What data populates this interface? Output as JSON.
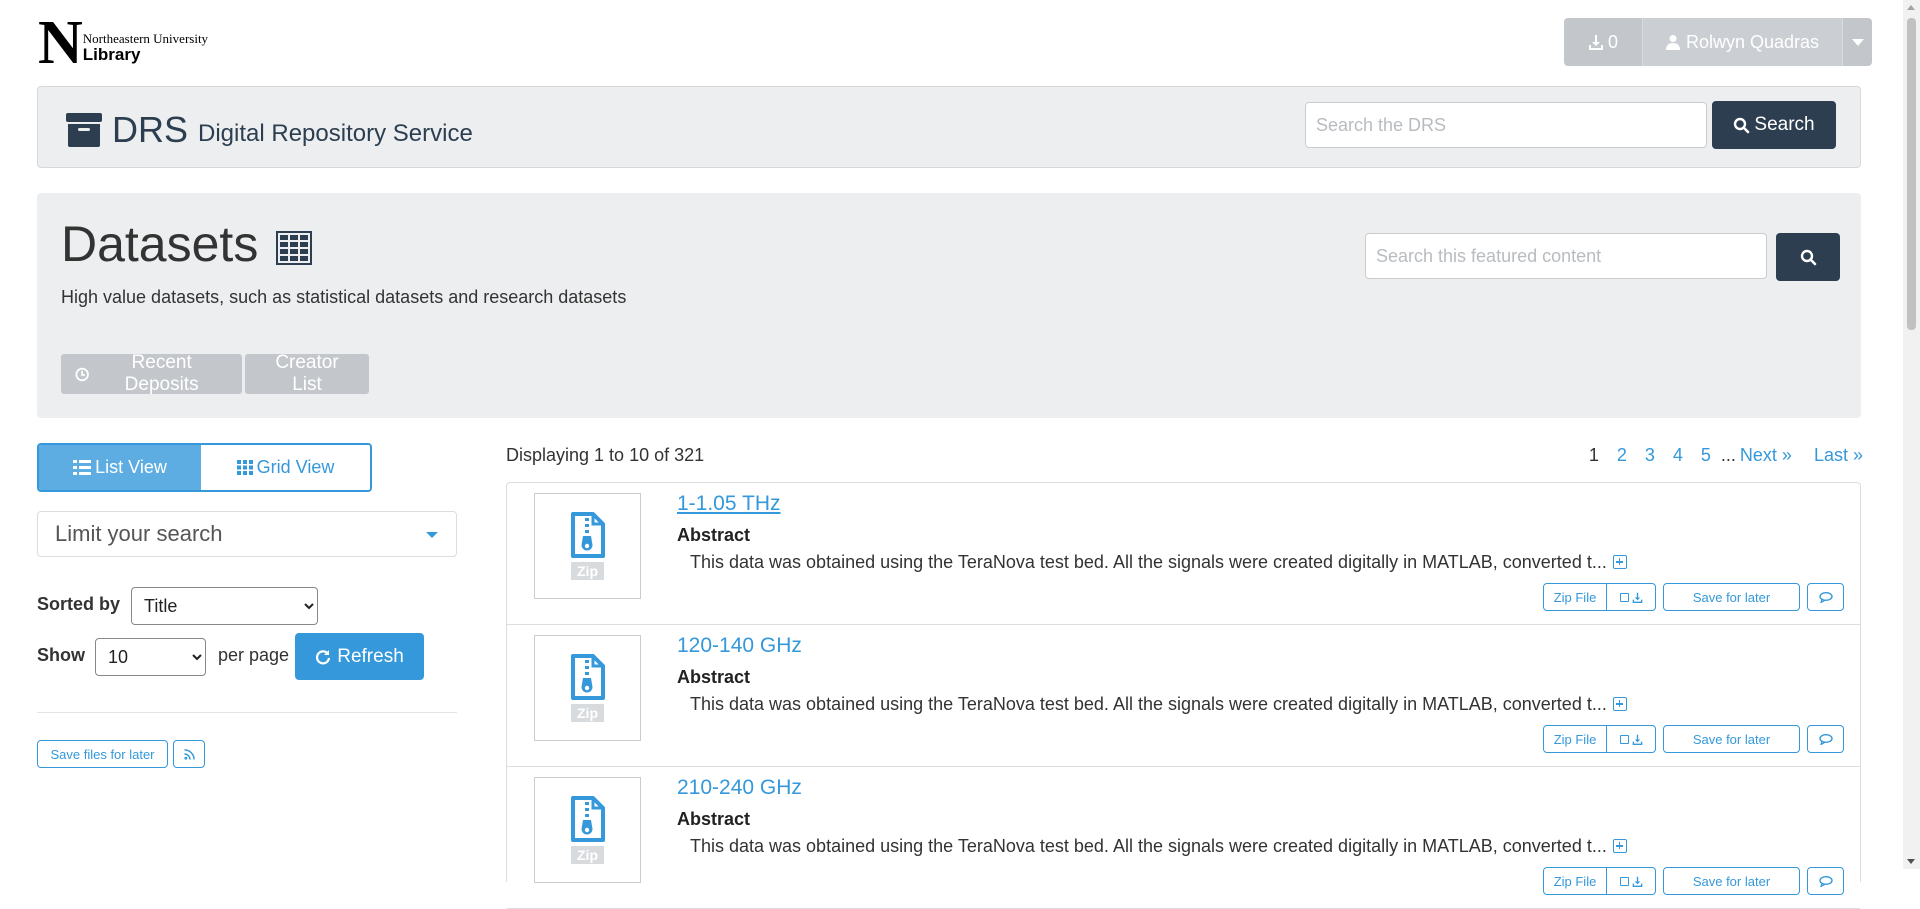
{
  "logo": {
    "letter": "N",
    "university": "Northeastern University",
    "library": "Library"
  },
  "user_menu": {
    "download_count": "0",
    "user_name": "Rolwyn Quadras"
  },
  "drs": {
    "title": "DRS",
    "subtitle": "Digital Repository Service",
    "search_placeholder": "Search the DRS",
    "search_button": "Search"
  },
  "banner": {
    "title": "Datasets",
    "description": "High value datasets, such as statistical datasets and research datasets",
    "search_placeholder": "Search this featured content",
    "buttons": {
      "recent": "Recent Deposits",
      "creators": "Creator List"
    }
  },
  "view": {
    "list_label": "List View",
    "grid_label": "Grid View"
  },
  "filters": {
    "limit_label": "Limit your search",
    "sorted_by_label": "Sorted by",
    "sort_value": "Title",
    "show_label": "Show",
    "show_value": "10",
    "per_page_label": "per page",
    "refresh_label": "Refresh"
  },
  "left_actions": {
    "save_files_label": "Save files for later"
  },
  "results": {
    "summary": "Displaying 1 to 10 of 321",
    "pages": [
      "1",
      "2",
      "3",
      "4",
      "5"
    ],
    "ellipsis": "...",
    "next_label": "Next »",
    "last_label": "Last »",
    "items": [
      {
        "title": "1-1.05 THz",
        "abstract_label": "Abstract",
        "abstract": "This data was obtained using the TeraNova test bed. All the signals were created digitally in MATLAB, converted t...",
        "thumb_label": "Zip",
        "zip_label": "Zip File",
        "save_label": "Save for later"
      },
      {
        "title": "120-140 GHz",
        "abstract_label": "Abstract",
        "abstract": "This data was obtained using the TeraNova test bed. All the signals were created digitally in MATLAB, converted t...",
        "thumb_label": "Zip",
        "zip_label": "Zip File",
        "save_label": "Save for later"
      },
      {
        "title": "210-240 GHz",
        "abstract_label": "Abstract",
        "abstract": "This data was obtained using the TeraNova test bed. All the signals were created digitally in MATLAB, converted t...",
        "thumb_label": "Zip",
        "zip_label": "Zip File",
        "save_label": "Save for later"
      }
    ]
  },
  "colors": {
    "primary": "#3498db",
    "navy": "#2c3e50",
    "panel": "#eceeef",
    "muted_button": "#c3c7cb"
  },
  "icons": [
    "download-icon",
    "user-icon",
    "archive-icon",
    "search-icon",
    "table-icon",
    "clock-icon",
    "list-icon",
    "grid-icon",
    "refresh-icon",
    "rss-icon",
    "zip-file-icon",
    "checkbox-icon",
    "comment-icon",
    "plus-square-icon"
  ]
}
